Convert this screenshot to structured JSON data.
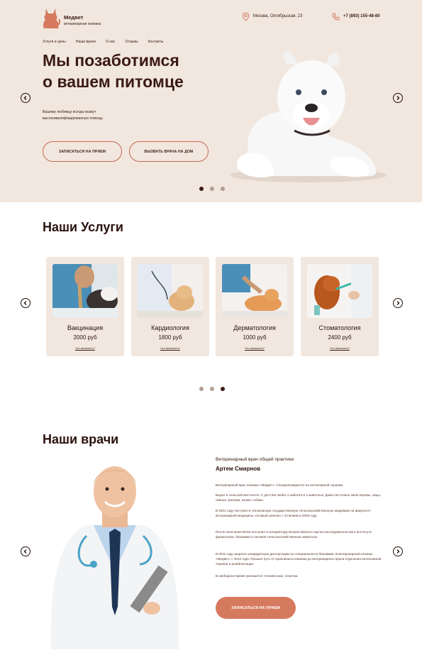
{
  "header": {
    "brand_name": "Медвет",
    "brand_sub": "ветеринарная клиника",
    "address": "Москва, Октябрьская, 23",
    "phone": "+7 (893) 155-48-80"
  },
  "nav": {
    "items": [
      "Услуги и цены",
      "Наши врачи",
      "О нас",
      "Отзывы",
      "Контакты"
    ]
  },
  "hero": {
    "title_line1": "Мы позаботимся",
    "title_line2": "о вашем питомце",
    "subtitle_line1": "Вашему любимцу всегда окажут",
    "subtitle_line2": "высококвалифицированную помощь",
    "book_button": "ЗАПИСАТЬСЯ НА ПРИЕМ",
    "call_button": "ВЫЗВАТЬ ВРАЧА НА ДОМ",
    "slide_index": 1,
    "slide_count": 3
  },
  "services": {
    "title": "Наши Услуги",
    "cards": [
      {
        "name": "Вакцинация",
        "price": "2000 руб",
        "link": "Что включено?"
      },
      {
        "name": "Кардиология",
        "price": "1800 руб",
        "link": "Что включено?"
      },
      {
        "name": "Дерматология",
        "price": "1000 руб",
        "link": "Что включено?"
      },
      {
        "name": "Стоматология",
        "price": "2400 руб",
        "link": "Что включено?"
      }
    ],
    "slide_index": 3,
    "slide_count": 3
  },
  "doctors": {
    "title": "Наши врачи",
    "role": "Ветеринарный врач общей практики",
    "name": "Артем Смирнов",
    "paragraphs": [
      "Ветеринарный врач клиники «Медвет». Специализируется на интенсивной терапии.",
      "Вырос в сельской местности. С детства любит и заботится о животных. Дома постоянно жили коровы, овцы, свиньи, кролики, кошки, собаки.",
      "В 2001 году поступил в Ульяновскую государственную сельскохозяйственную академию на факультет ветеринарной медицины, который окончил с отличием в 2006 году.",
      "После окончания ВУЗа поступил в аспирантуру Всероссийского научно-исследовательского института физиологии, биохимии и питания сельскохозяйственных животных.",
      "В 2011 году защитил кандидатскую диссертацию по специальности биохимия. В ветеринарной клинике «Медвет» с 2012 года. Прошел путь от практиканта клиники до ветеринарного врача отделения интенсивной терапии и реабилитации.",
      "В свободное время увлекается чтением книг, спортом."
    ],
    "book_button": "ЗАПИСАТЬСЯ НА ПРИЕМ"
  },
  "colors": {
    "hero_bg": "#f1e7df",
    "accent": "#d67a5f",
    "text_dark": "#3a1a12",
    "dot_inactive": "#b39d92"
  },
  "icons": [
    "cat-logo-icon",
    "location-pin-icon",
    "phone-icon",
    "chevron-left-icon",
    "chevron-right-icon"
  ]
}
